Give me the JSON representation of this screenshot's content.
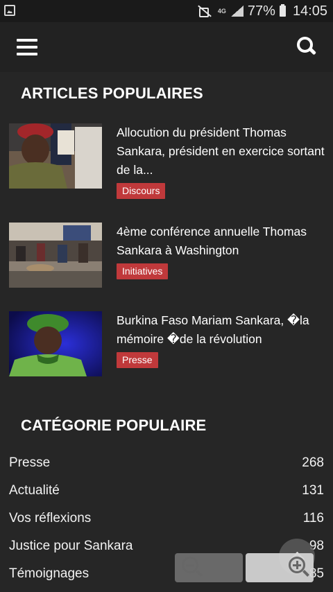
{
  "status_bar": {
    "battery_percent": "77%",
    "time": "14:05",
    "network_type": "4G",
    "icons": [
      "image-icon",
      "mute-icon",
      "signal-icon",
      "battery-icon"
    ]
  },
  "app_bar": {
    "icons": [
      "menu-icon",
      "search-icon"
    ]
  },
  "sections": {
    "articles_title": "ARTICLES POPULAIRES",
    "categories_title": "CATÉGORIE POPULAIRE"
  },
  "articles": [
    {
      "title": "Allocution du président Thomas Sankara, président en exercice sortant de la...",
      "tag": "Discours"
    },
    {
      "title": "4ème conférence annuelle Thomas Sankara à Washington",
      "tag": "Initiatives"
    },
    {
      "title": "Burkina Faso Mariam Sankara, �la mémoire �de la révolution",
      "tag": "Presse"
    }
  ],
  "categories": [
    {
      "name": "Presse",
      "count": "268"
    },
    {
      "name": "Actualité",
      "count": "131"
    },
    {
      "name": "Vos réflexions",
      "count": "116"
    },
    {
      "name": "Justice pour Sankara",
      "count": "98"
    },
    {
      "name": "Témoignages",
      "count": "85"
    }
  ],
  "colors": {
    "background": "#262626",
    "tag": "#c0393b"
  }
}
